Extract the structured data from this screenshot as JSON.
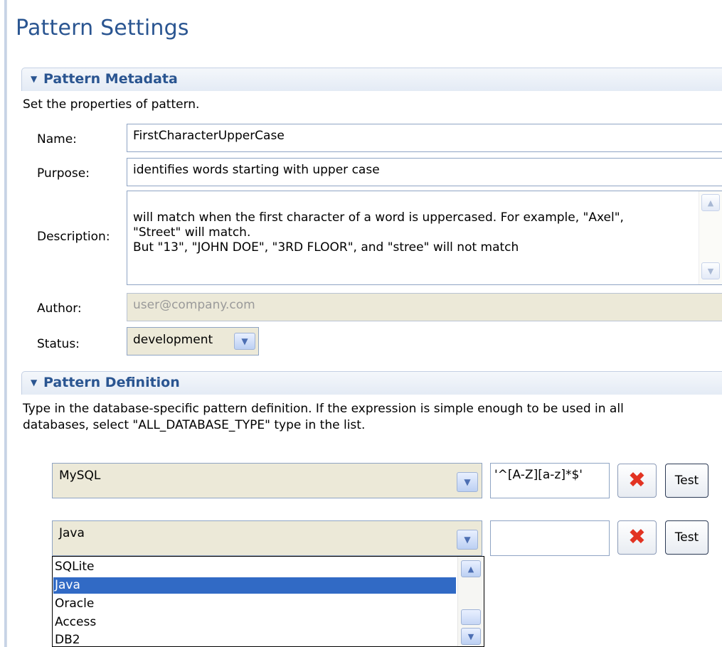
{
  "page": {
    "title": "Pattern Settings"
  },
  "metadata_section": {
    "title": "Pattern Metadata",
    "description": "Set the properties of pattern.",
    "name_label": "Name:",
    "name_value": "FirstCharacterUpperCase",
    "purpose_label": "Purpose:",
    "purpose_value": "identifies words starting with upper case",
    "description_label": "Description:",
    "description_value": "will match when the first character of a word is uppercased. For example, \"Axel\",\n\"Street\" will match.\nBut \"13\", \"JOHN DOE\", \"3RD FLOOR\", and \"stree\" will not match",
    "author_label": "Author:",
    "author_value": "user@company.com",
    "status_label": "Status:",
    "status_value": "development"
  },
  "definition_section": {
    "title": "Pattern Definition",
    "description_line1": "Type in the database-specific pattern definition. If the expression is simple enough to be used in all",
    "description_line2": "databases, select \"ALL_DATABASE_TYPE\" type in the list.",
    "rows": [
      {
        "db": "MySQL",
        "expression": "'^[A-Z][a-z]*$'",
        "test_label": "Test"
      },
      {
        "db": "Java",
        "expression": "",
        "test_label": "Test"
      }
    ],
    "dropdown_options": [
      "SQLite",
      "Java",
      "Oracle",
      "Access",
      "DB2"
    ],
    "dropdown_selected": "Java"
  },
  "icons": {
    "collapse": "triangle-down-icon",
    "delete": "red-x-icon",
    "dropdown": "chevron-down-icon"
  },
  "colors": {
    "title": "#2a5591",
    "selection": "#316ac5",
    "delete": "#e23322"
  }
}
